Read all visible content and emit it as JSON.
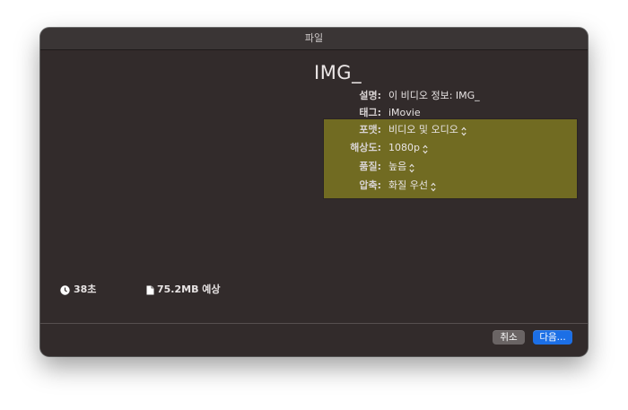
{
  "window": {
    "title": "파일"
  },
  "document": {
    "title": "IMG_"
  },
  "fields": {
    "description": {
      "label": "설명:",
      "value": "이 비디오 정보: IMG_"
    },
    "tags": {
      "label": "태그:",
      "value": "iMovie"
    },
    "format": {
      "label": "포맷:",
      "value": "비디오 및 오디오"
    },
    "resolution": {
      "label": "해상도:",
      "value": "1080p"
    },
    "quality": {
      "label": "품질:",
      "value": "높음"
    },
    "compress": {
      "label": "압축:",
      "value": "화질 우선"
    }
  },
  "info": {
    "duration": "38초",
    "size": "75.2MB 예상"
  },
  "buttons": {
    "cancel": "취소",
    "next": "다음..."
  },
  "colors": {
    "window_bg": "#322b2b",
    "highlight": "#716b22",
    "accent": "#1c6fe6"
  },
  "icons": {
    "popup": "chevron-updown-icon",
    "duration": "clock-icon",
    "size": "document-icon"
  }
}
